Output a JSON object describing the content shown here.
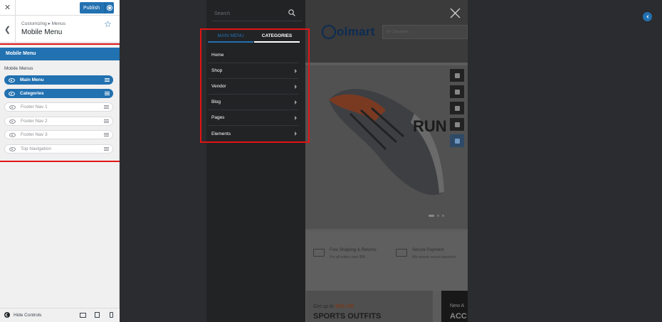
{
  "sidebar": {
    "publish_label": "Publish",
    "breadcrumb": "Customizing ▸ Menus",
    "section_title": "Mobile Menu",
    "panel_header": "Mobile Menu",
    "group_label": "Mobile Menus",
    "items": [
      {
        "label": "Main Menu",
        "active": true
      },
      {
        "label": "Categories",
        "active": true
      },
      {
        "label": "Footer Nav 1",
        "active": false
      },
      {
        "label": "Footer Nav 2",
        "active": false
      },
      {
        "label": "Footer Nav 3",
        "active": false
      },
      {
        "label": "Top Navigation",
        "active": false
      }
    ],
    "hide_controls_label": "Hide Controls",
    "accent_color": "#2271b1"
  },
  "mobile_menu": {
    "search_placeholder": "Search",
    "tabs": [
      {
        "label": "MAIN MENU",
        "active": false
      },
      {
        "label": "CATEGORIES",
        "active": true
      }
    ],
    "items": [
      {
        "label": "Home",
        "has_children": false
      },
      {
        "label": "Shop",
        "has_children": true
      },
      {
        "label": "Vendor",
        "has_children": true
      },
      {
        "label": "Blog",
        "has_children": true
      },
      {
        "label": "Pages",
        "has_children": true
      },
      {
        "label": "Elements",
        "has_children": true
      }
    ]
  },
  "site": {
    "logo_text": "olmart",
    "category_select": "All Categories",
    "hero_text": "RUN",
    "features": [
      {
        "title": "Free Shipping & Returns",
        "subtitle": "For all orders over $99"
      },
      {
        "title": "Secure Payment",
        "subtitle": "We ensure secure payment"
      }
    ],
    "promo_sub_prefix": "Get up to ",
    "promo_sub_value": "20% Off",
    "promo_title": "SPORTS OUTFITS",
    "promo2_top": "New A",
    "promo2_title": "ACC"
  },
  "highlight_color": "#e31414"
}
